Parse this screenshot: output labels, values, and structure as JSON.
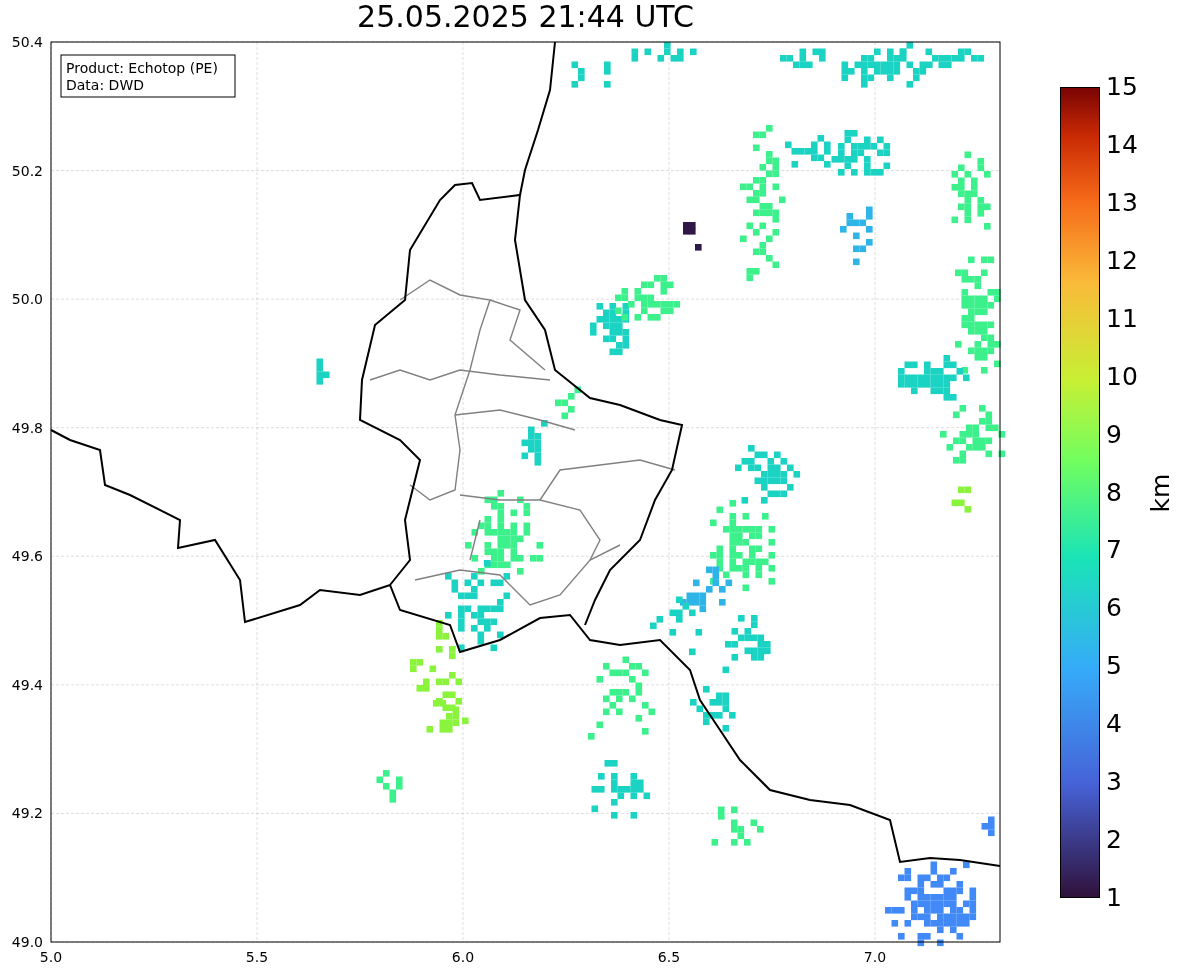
{
  "title": "25.05.2025 21:44 UTC",
  "legend": {
    "lines": [
      "Product: Echotop (PE)",
      "Data: DWD"
    ]
  },
  "x_axis": {
    "ticks": [
      "5.0",
      "5.5",
      "6.0",
      "6.5",
      "7.0"
    ]
  },
  "y_axis": {
    "ticks": [
      "50.4",
      "50.2",
      "50.0",
      "49.8",
      "49.6",
      "49.4",
      "49.2",
      "49.0"
    ]
  },
  "colorbar": {
    "label": "km",
    "ticks": [
      "15",
      "14",
      "13",
      "12",
      "11",
      "10",
      "9",
      "8",
      "7",
      "6",
      "5",
      "4",
      "3",
      "2",
      "1"
    ]
  }
}
